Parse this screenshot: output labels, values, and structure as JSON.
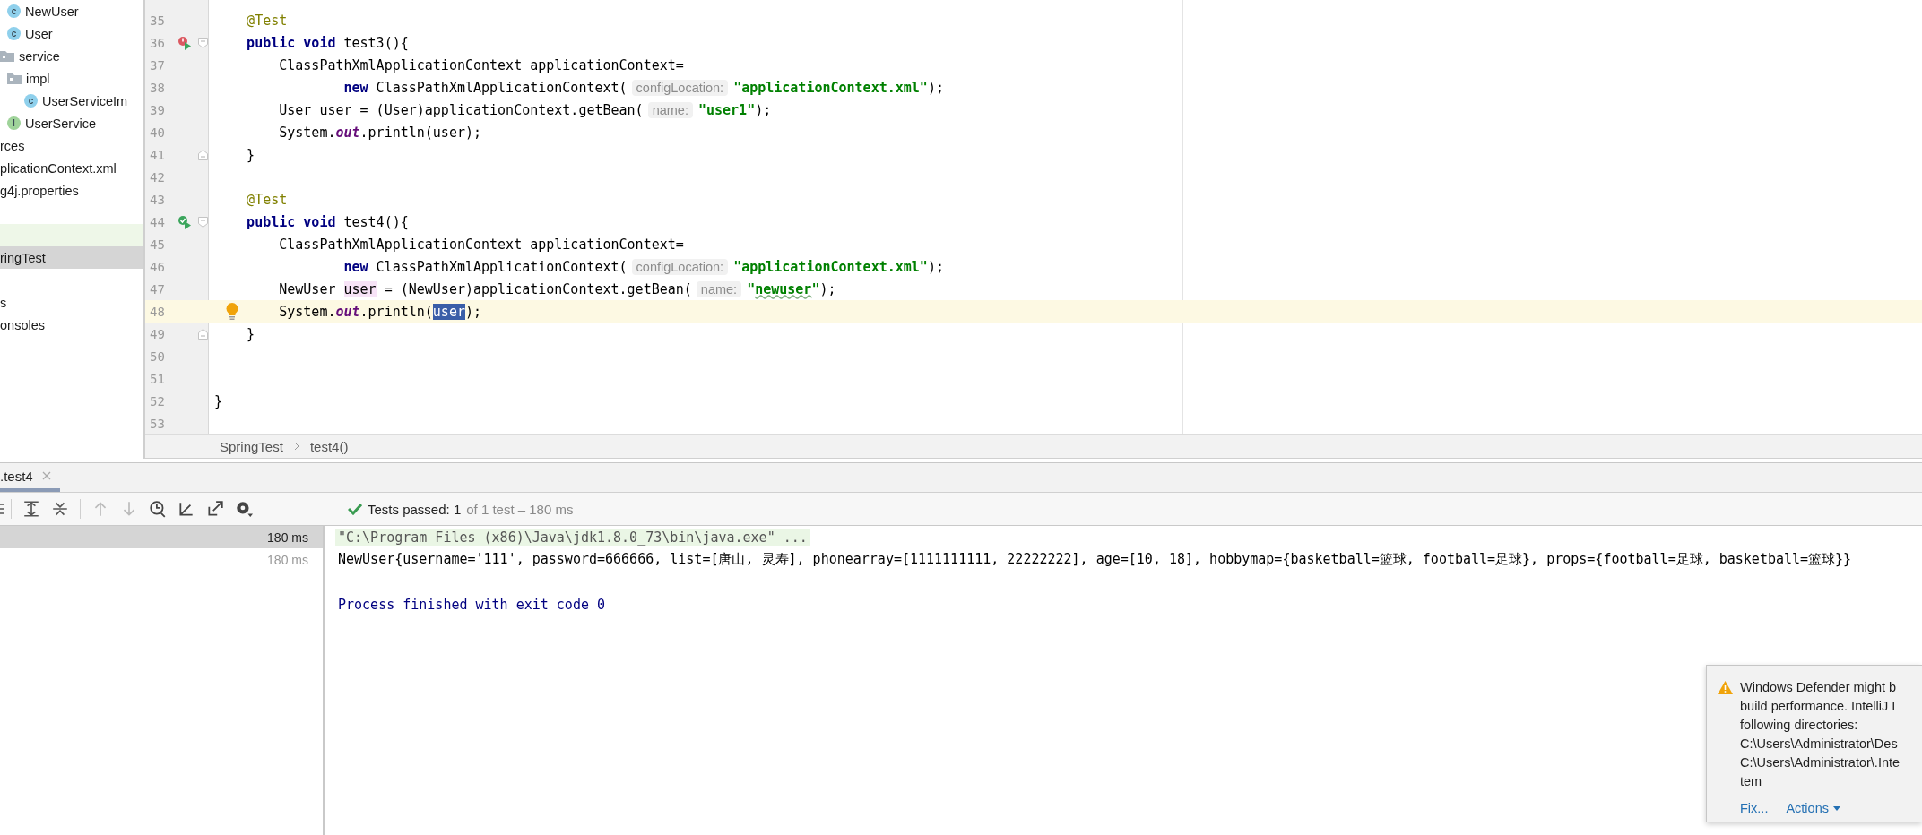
{
  "project_tree": [
    {
      "label": "NewUser",
      "kind": "class",
      "icon_letter": "c",
      "selected": false
    },
    {
      "label": "User",
      "kind": "class",
      "icon_letter": "c",
      "selected": false
    },
    {
      "label": "service",
      "kind": "folder",
      "selected": false,
      "children": [
        {
          "label": "impl",
          "kind": "folder",
          "selected": false,
          "children": [
            {
              "label": "UserServiceIm",
              "kind": "class",
              "icon_letter": "c",
              "selected": false
            }
          ]
        },
        {
          "label": "UserService",
          "kind": "interface",
          "icon_letter": "I",
          "selected": false
        }
      ]
    },
    {
      "label": "rces",
      "kind": "plain",
      "selected": false
    },
    {
      "label": "plicationContext.xml",
      "kind": "plain",
      "selected": false
    },
    {
      "label": "g4j.properties",
      "kind": "plain",
      "selected": false
    },
    {
      "kind": "blank"
    },
    {
      "kind": "changed",
      "selected": false
    },
    {
      "label": "ringTest",
      "kind": "plain",
      "selected": true
    },
    {
      "kind": "blank"
    },
    {
      "label": "s",
      "kind": "plain",
      "selected": false
    },
    {
      "label": "onsoles",
      "kind": "plain",
      "selected": false
    }
  ],
  "editor": {
    "lines": [
      {
        "number": "35",
        "current": false,
        "bulb": false,
        "segments": [
          {
            "kind": "ann",
            "text": "    @Test"
          }
        ]
      },
      {
        "number": "36",
        "current": false,
        "bulb": false,
        "gutter": {
          "kind": "run-failed"
        },
        "fold": {
          "kind": "start"
        },
        "segments": [
          {
            "kind": "kw",
            "text": "    public void"
          },
          {
            "kind": "plain",
            "text": " test3(){"
          }
        ]
      },
      {
        "number": "37",
        "current": false,
        "bulb": false,
        "segments": [
          {
            "kind": "plain",
            "text": "        ClassPathXmlApplicationContext applicationContext="
          }
        ]
      },
      {
        "number": "38",
        "current": false,
        "bulb": false,
        "segments": [
          {
            "kind": "kw",
            "text": "                new"
          },
          {
            "kind": "plain",
            "text": " ClassPathXmlApplicationContext("
          },
          {
            "kind": "hint",
            "text": "configLocation:"
          },
          {
            "kind": "str",
            "text": "\"applicationContext.xml\""
          },
          {
            "kind": "plain",
            "text": ");"
          }
        ]
      },
      {
        "number": "39",
        "current": false,
        "bulb": false,
        "segments": [
          {
            "kind": "plain",
            "text": "        User user = (User)applicationContext.getBean("
          },
          {
            "kind": "hint",
            "text": "name:"
          },
          {
            "kind": "str",
            "text": "\"user1\""
          },
          {
            "kind": "plain",
            "text": ");"
          }
        ]
      },
      {
        "number": "40",
        "current": false,
        "bulb": false,
        "segments": [
          {
            "kind": "plain",
            "text": "        System."
          },
          {
            "kind": "field",
            "text": "out"
          },
          {
            "kind": "plain",
            "text": ".println(user);"
          }
        ]
      },
      {
        "number": "41",
        "current": false,
        "bulb": false,
        "fold": {
          "kind": "end"
        },
        "segments": [
          {
            "kind": "plain",
            "text": "    }"
          }
        ]
      },
      {
        "number": "42",
        "current": false,
        "bulb": false
      },
      {
        "number": "43",
        "current": false,
        "bulb": false,
        "segments": [
          {
            "kind": "ann",
            "text": "    @Test"
          }
        ]
      },
      {
        "number": "44",
        "current": false,
        "bulb": false,
        "gutter": {
          "kind": "run-passed"
        },
        "fold": {
          "kind": "start"
        },
        "segments": [
          {
            "kind": "kw",
            "text": "    public void"
          },
          {
            "kind": "plain",
            "text": " test4(){"
          }
        ]
      },
      {
        "number": "45",
        "current": false,
        "bulb": false,
        "segments": [
          {
            "kind": "plain",
            "text": "        ClassPathXmlApplicationContext applicationContext="
          }
        ]
      },
      {
        "number": "46",
        "current": false,
        "bulb": false,
        "segments": [
          {
            "kind": "kw",
            "text": "                new"
          },
          {
            "kind": "plain",
            "text": " ClassPathXmlApplicationContext("
          },
          {
            "kind": "hint",
            "text": "configLocation:"
          },
          {
            "kind": "str",
            "text": "\"applicationContext.xml\""
          },
          {
            "kind": "plain",
            "text": ");"
          }
        ]
      },
      {
        "number": "47",
        "current": false,
        "bulb": false,
        "segments": [
          {
            "kind": "plain",
            "text": "        NewUser "
          },
          {
            "kind": "usage",
            "text": "user"
          },
          {
            "kind": "plain",
            "text": " = (NewUser)applicationContext.getBean("
          },
          {
            "kind": "hint",
            "text": "name:"
          },
          {
            "kind": "str",
            "text": "\""
          },
          {
            "kind": "typo",
            "text": "newuser"
          },
          {
            "kind": "str",
            "text": "\""
          },
          {
            "kind": "plain",
            "text": ");"
          }
        ]
      },
      {
        "number": "48",
        "current": true,
        "bulb": true,
        "segments": [
          {
            "kind": "plain",
            "text": "        System."
          },
          {
            "kind": "field",
            "text": "out"
          },
          {
            "kind": "plain",
            "text": ".println("
          },
          {
            "kind": "selection",
            "text": "user"
          },
          {
            "kind": "plain",
            "text": ");"
          }
        ]
      },
      {
        "number": "49",
        "current": false,
        "bulb": false,
        "fold": {
          "kind": "end"
        },
        "segments": [
          {
            "kind": "plain",
            "text": "    }"
          }
        ]
      },
      {
        "number": "50",
        "current": false,
        "bulb": false
      },
      {
        "number": "51",
        "current": false,
        "bulb": false
      },
      {
        "number": "52",
        "current": false,
        "bulb": false,
        "segments": [
          {
            "kind": "plain",
            "text": "}"
          }
        ]
      },
      {
        "number": "53",
        "current": false,
        "bulb": false
      }
    ],
    "breadcrumbs": [
      "SpringTest",
      "test4()"
    ]
  },
  "run_panel": {
    "tab": {
      "label": ".test4",
      "selected": true
    },
    "status": {
      "passed": "Tests passed: 1",
      "detail": "of 1 test – 180 ms"
    },
    "tests": [
      {
        "time": "180 ms",
        "selected": true
      },
      {
        "time": "180 ms",
        "selected": false
      }
    ],
    "console": [
      {
        "kind": "command",
        "text": "\"C:\\Program Files (x86)\\Java\\jdk1.8.0_73\\bin\\java.exe\" ..."
      },
      {
        "kind": "output",
        "text": "NewUser{username='111', password=666666, list=[唐山, 灵寿], phonearray=[1111111111, 22222222], age=[10, 18], hobbymap={basketball=篮球, football=足球}, props={football=足球, basketball=篮球}}"
      },
      {
        "kind": "blank"
      },
      {
        "kind": "exit",
        "text": "Process finished with exit code 0"
      }
    ]
  },
  "notification": {
    "lines": [
      "Windows Defender might b",
      "build performance. IntelliJ I",
      "following directories:",
      "C:\\Users\\Administrator\\Des",
      "C:\\Users\\Administrator\\.Inte",
      "tem"
    ],
    "actions": [
      {
        "label": "Fix...",
        "dropdown": false
      },
      {
        "label": "Actions",
        "dropdown": true
      }
    ]
  }
}
